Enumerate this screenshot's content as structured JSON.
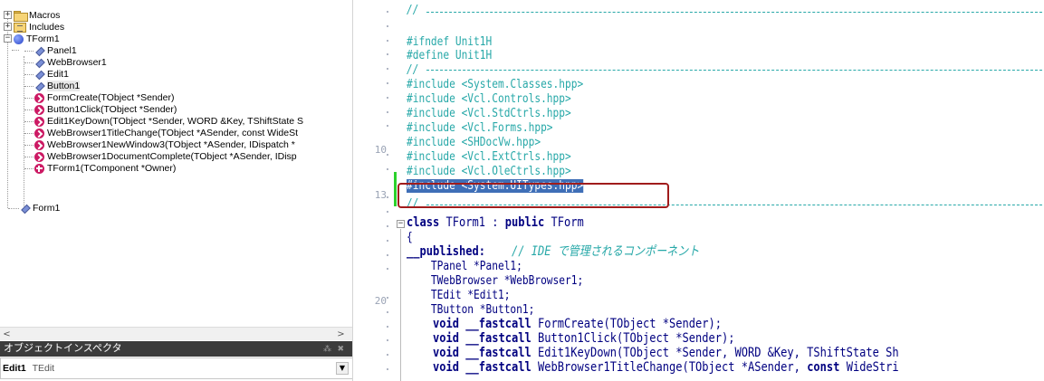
{
  "tree": {
    "items": [
      {
        "label": "Macros"
      },
      {
        "label": "Includes"
      },
      {
        "label": "TForm1"
      },
      {
        "label": "Panel1"
      },
      {
        "label": "WebBrowser1"
      },
      {
        "label": "Edit1"
      },
      {
        "label": "Button1"
      },
      {
        "label": "FormCreate(TObject *Sender)"
      },
      {
        "label": "Button1Click(TObject *Sender)"
      },
      {
        "label": "Edit1KeyDown(TObject *Sender, WORD &Key, TShiftState S"
      },
      {
        "label": "WebBrowser1TitleChange(TObject *ASender, const WideSt"
      },
      {
        "label": "WebBrowser1NewWindow3(TObject *ASender, IDispatch *"
      },
      {
        "label": "WebBrowser1DocumentComplete(TObject *ASender, IDisp"
      },
      {
        "label": "TForm1(TComponent *Owner)"
      },
      {
        "label": "Form1"
      }
    ],
    "scroll_left": "<",
    "scroll_right": ">"
  },
  "inspector": {
    "title": "オブジェクトインスペクタ",
    "pins": "⁂ ✖",
    "object_name": "Edit1",
    "object_type": "TEdit",
    "dropdown_icon": "▼"
  },
  "editor": {
    "line_numbers": {
      "l10": "10",
      "l13": "13",
      "l20": "20"
    },
    "code": {
      "l1": "//",
      "l3": "#ifndef Unit1H",
      "l4": "#define Unit1H",
      "l5": "//",
      "l6": "#include <System.Classes.hpp>",
      "l7": "#include <Vcl.Controls.hpp>",
      "l8": "#include <Vcl.StdCtrls.hpp>",
      "l9": "#include <Vcl.Forms.hpp>",
      "l10": "#include <SHDocVw.hpp>",
      "l11": "#include <Vcl.ExtCtrls.hpp>",
      "l12": "#include <Vcl.OleCtrls.hpp>",
      "l13": "#include <System.UITypes.hpp>",
      "l14": "//",
      "l15a": "class",
      "l15b": " TForm1 : ",
      "l15c": "public",
      "l15d": " TForm",
      "l16": "{",
      "l17a": "__published:",
      "l17b": "    // IDE で管理されるコンポーネント",
      "l18": "    TPanel *Panel1;",
      "l19": "    TWebBrowser *WebBrowser1;",
      "l20": "    TEdit *Edit1;",
      "l21": "    TButton *Button1;",
      "l22a": "    void ",
      "l22b": "__fastcall",
      "l22c": " FormCreate(TObject *Sender);",
      "l23a": "    void ",
      "l23b": "__fastcall",
      "l23c": " Button1Click(TObject *Sender);",
      "l24a": "    void ",
      "l24b": "__fastcall",
      "l24c": " Edit1KeyDown(TObject *Sender, WORD &Key, TShiftState Sh",
      "l25a": "    void ",
      "l25b": "__fastcall",
      "l25c": " WebBrowser1TitleChange(TObject *ASender, ",
      "l25d": "const",
      "l25e": " WideStri"
    }
  },
  "colors": {
    "comment": "#27a8a8",
    "keyword": "#000080",
    "selection": "#3f6fb7",
    "highlight_box": "#a01c1c",
    "change_bar": "#2cd12c",
    "inspector_header": "#3c3c3c"
  }
}
